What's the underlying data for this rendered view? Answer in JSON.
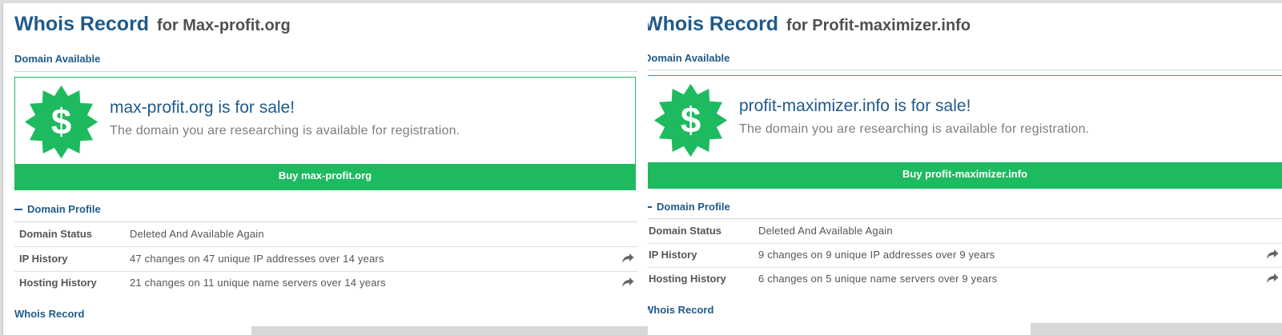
{
  "colors": {
    "brand_blue": "#1f5a8a",
    "sale_green": "#1eba5f",
    "label_gray": "#555555"
  },
  "left": {
    "title": "Whois Record",
    "title_for": "for Max-profit.org",
    "availability": "Domain Available",
    "sale_title": "max-profit.org is for sale!",
    "sale_subtitle": "The domain you are researching is available for registration.",
    "buy_label": "Buy max-profit.org",
    "badge_symbol": "$",
    "profile_heading": "Domain Profile",
    "rows": [
      {
        "label": "Domain Status",
        "value": "Deleted And Available Again"
      },
      {
        "label": "IP History",
        "value": "47 changes on 47 unique IP addresses over 14 years"
      },
      {
        "label": "Hosting History",
        "value": "21 changes on 11 unique name servers over 14 years"
      }
    ],
    "whois_link": "Whois Record"
  },
  "right": {
    "title": "Whois Record",
    "title_for": "for Profit-maximizer.info",
    "availability": "Domain Available",
    "sale_title": "profit-maximizer.info is for sale!",
    "sale_subtitle": "The domain you are researching is available for registration.",
    "buy_label": "Buy profit-maximizer.info",
    "badge_symbol": "$",
    "profile_heading": "Domain Profile",
    "rows": [
      {
        "label": "Domain Status",
        "value": "Deleted And Available Again"
      },
      {
        "label": "IP History",
        "value": "9 changes on 9 unique IP addresses over 9 years"
      },
      {
        "label": "Hosting History",
        "value": "6 changes on 5 unique name servers over 9 years"
      }
    ],
    "whois_link": "Whois Record"
  },
  "icons": {
    "badge": "dollar-badge-icon",
    "share": "share-arrow-icon",
    "collapse": "minus-icon"
  }
}
